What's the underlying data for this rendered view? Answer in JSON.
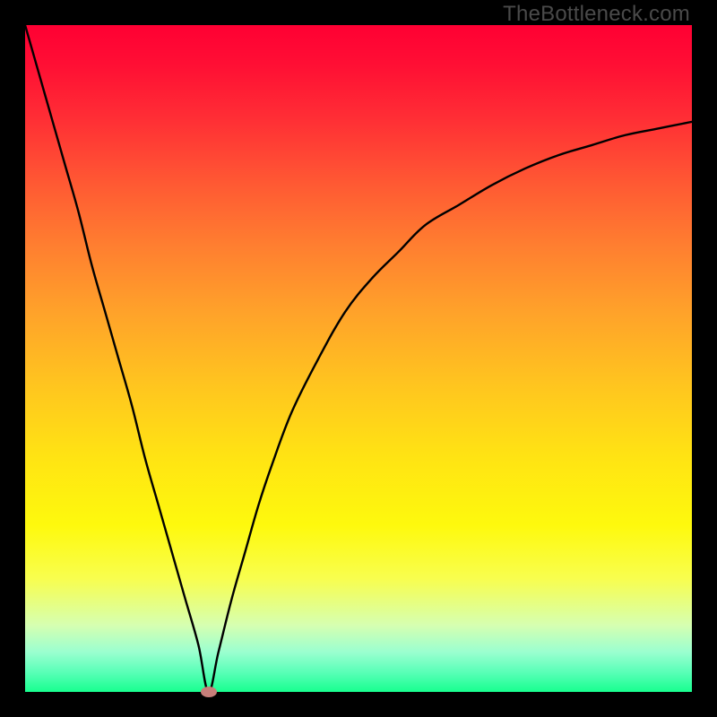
{
  "watermark": "TheBottleneck.com",
  "colors": {
    "frame": "#000000",
    "curve": "#000000",
    "marker": "#c77f7a"
  },
  "chart_data": {
    "type": "line",
    "title": "",
    "xlabel": "",
    "ylabel": "",
    "xlim": [
      0,
      100
    ],
    "ylim": [
      0,
      100
    ],
    "gradient_meaning": "green (bottom) = optimal / no bottleneck, red (top) = severe bottleneck",
    "series": [
      {
        "name": "bottleneck-curve",
        "x": [
          0,
          2,
          4,
          6,
          8,
          10,
          12,
          14,
          16,
          18,
          20,
          22,
          24,
          26,
          27.5,
          29,
          31,
          33,
          35,
          37,
          40,
          44,
          48,
          52,
          56,
          60,
          65,
          70,
          75,
          80,
          85,
          90,
          95,
          100
        ],
        "y": [
          100,
          93,
          86,
          79,
          72,
          64,
          57,
          50,
          43,
          35,
          28,
          21,
          14,
          7,
          0,
          6,
          14,
          21,
          28,
          34,
          42,
          50,
          57,
          62,
          66,
          70,
          73,
          76,
          78.5,
          80.5,
          82,
          83.5,
          84.5,
          85.5
        ]
      }
    ],
    "marker": {
      "x": 27.5,
      "y": 0,
      "meaning": "optimal balance point"
    }
  }
}
